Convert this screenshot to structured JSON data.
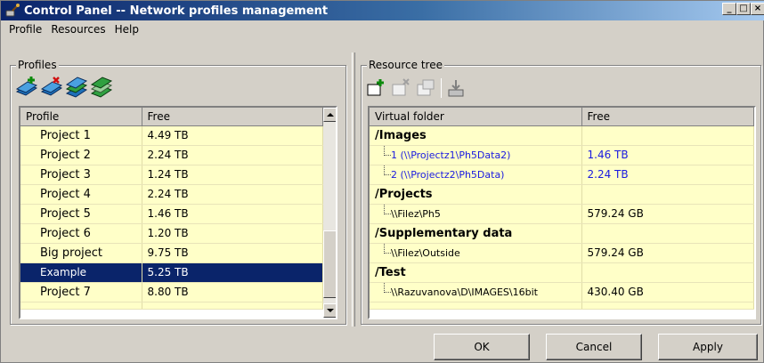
{
  "window": {
    "title": "Control Panel -- Network profiles management",
    "controls": {
      "minimize": "_",
      "maximize": "□",
      "close": "×"
    }
  },
  "menu": [
    "Profile",
    "Resources",
    "Help"
  ],
  "profiles": {
    "group_title": "Profiles",
    "toolbar_icons": [
      "add-profile-icon",
      "delete-profile-icon",
      "profile-stack-icon",
      "profile-stack-green-icon"
    ],
    "columns": [
      "Profile",
      "Free"
    ],
    "rows": [
      {
        "name": "Project 1",
        "free": "4.49 TB"
      },
      {
        "name": "Project 2",
        "free": "2.24 TB"
      },
      {
        "name": "Project 3",
        "free": "1.24 TB"
      },
      {
        "name": "Project 4",
        "free": "2.24 TB"
      },
      {
        "name": "Project 5",
        "free": "1.46 TB"
      },
      {
        "name": "Project 6",
        "free": "1.20 TB"
      },
      {
        "name": "Big project",
        "free": "9.75 TB"
      },
      {
        "name": "Example",
        "free": "5.25 TB",
        "selected": true
      },
      {
        "name": "Project 7",
        "free": "8.80 TB"
      }
    ]
  },
  "resources": {
    "group_title": "Resource tree",
    "toolbar_icons": [
      "add-folder-icon",
      "remove-folder-icon",
      "edit-folder-icon",
      "mount-icon"
    ],
    "columns": [
      "Virtual folder",
      "Free"
    ],
    "rows": [
      {
        "kind": "folder",
        "label": "/Images",
        "free": ""
      },
      {
        "kind": "link",
        "label": "1 (\\\\Projectz1\\Ph5Data2)",
        "free": "1.46 TB"
      },
      {
        "kind": "link",
        "label": "2 (\\\\Projectz2\\Ph5Data)",
        "free": "2.24 TB"
      },
      {
        "kind": "folder",
        "label": "/Projects",
        "free": ""
      },
      {
        "kind": "path",
        "label": "\\\\Filez\\Ph5",
        "free": "579.24 GB"
      },
      {
        "kind": "folder",
        "label": "/Supplementary data",
        "free": ""
      },
      {
        "kind": "path",
        "label": "\\\\Filez\\Outside",
        "free": "579.24 GB"
      },
      {
        "kind": "folder",
        "label": "/Test",
        "free": ""
      },
      {
        "kind": "path",
        "label": "\\\\Razuvanova\\D\\IMAGES\\16bit",
        "free": "430.40 GB"
      }
    ]
  },
  "buttons": {
    "ok": "OK",
    "cancel": "Cancel",
    "apply": "Apply"
  },
  "colors": {
    "title_start": "#0a246a",
    "title_end": "#a6caf0",
    "row_bg": "#ffffc8",
    "selection": "#0a246a",
    "link": "#1a1ae0"
  }
}
